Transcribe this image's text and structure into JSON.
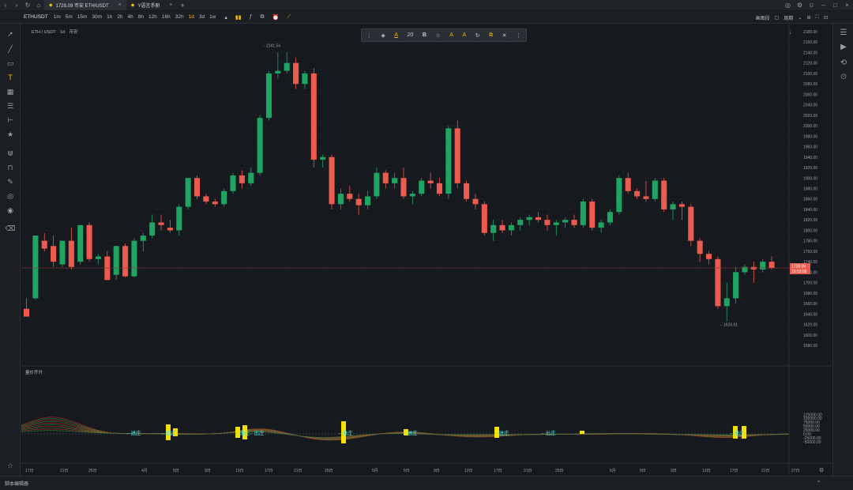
{
  "tabs": [
    {
      "label": "1728.09 币安 ETH/USDT",
      "active": true
    },
    {
      "label": "Y语言手册",
      "active": false
    }
  ],
  "toolbar": {
    "symbol": "ETHUSDT",
    "intervals": [
      "1m",
      "5m",
      "15m",
      "30m",
      "1h",
      "2h",
      "4h",
      "8h",
      "12h",
      "16h",
      "32h",
      "1d",
      "3d",
      "1w"
    ],
    "selected_interval": "1d",
    "right_labels": [
      "画图段",
      "周期"
    ]
  },
  "legend": {
    "pair": "ETH / USDT",
    "interval": "1d",
    "exchange": "币安"
  },
  "drawing_toolbar": {
    "font_size": "20",
    "bold": "B"
  },
  "indicator": {
    "name": "量价齐升"
  },
  "price_axis": {
    "ticks": [
      "2180.00",
      "2160.00",
      "2140.00",
      "2120.00",
      "2100.00",
      "2080.00",
      "2060.00",
      "2040.00",
      "2020.00",
      "2000.00",
      "1980.00",
      "1960.00",
      "1940.00",
      "1920.00",
      "1900.00",
      "1880.00",
      "1860.00",
      "1840.00",
      "1820.00",
      "1800.00",
      "1780.00",
      "1760.00",
      "1740.00",
      "1720.00",
      "1700.00",
      "1680.00",
      "1660.00",
      "1640.00",
      "1620.00",
      "1600.00",
      "1580.00"
    ],
    "last_price": "1728.09",
    "countdown": "15:53:56"
  },
  "ind_axis": {
    "ticks": [
      "125000.00",
      "100000.00",
      "75000.00",
      "50000.00",
      "25000.00",
      "0.00",
      "-25000.00",
      "-50000.00"
    ]
  },
  "high_label": "2141.54",
  "low_label": "1626.01",
  "time_axis": {
    "labels": [
      "17日",
      "21日",
      "25日",
      "4月",
      "5日",
      "9日",
      "13日",
      "17日",
      "21日",
      "25日",
      "5月",
      "5日",
      "9日",
      "13日",
      "17日",
      "21日",
      "25日",
      "6月",
      "5日",
      "9日",
      "13日",
      "17日",
      "21日",
      "27日"
    ]
  },
  "signals": [
    "进庄",
    "出庄",
    "进庄",
    "出庄",
    "进庄",
    "进庄",
    "进庄",
    "出庄",
    "进庄"
  ],
  "bottom": {
    "script_editor": "脚本编辑器"
  },
  "colors": {
    "up": "#1fa463",
    "down": "#ec5b4d",
    "accent": "#f0b90b",
    "signal": "#4fe3e0",
    "volume": "#f5e100",
    "bg": "#161a1e"
  },
  "chart_data": {
    "type": "candlestick",
    "ohlc": [
      [
        1650,
        1670,
        1645,
        1635
      ],
      [
        1670,
        1790,
        1668,
        1790
      ],
      [
        1780,
        1795,
        1760,
        1765
      ],
      [
        1770,
        1790,
        1730,
        1740
      ],
      [
        1735,
        1780,
        1730,
        1780
      ],
      [
        1780,
        1805,
        1725,
        1730
      ],
      [
        1740,
        1810,
        1735,
        1810
      ],
      [
        1810,
        1815,
        1740,
        1745
      ],
      [
        1745,
        1755,
        1735,
        1750
      ],
      [
        1750,
        1760,
        1705,
        1705
      ],
      [
        1715,
        1770,
        1705,
        1770
      ],
      [
        1770,
        1775,
        1710,
        1712
      ],
      [
        1712,
        1785,
        1710,
        1780
      ],
      [
        1780,
        1795,
        1760,
        1790
      ],
      [
        1790,
        1830,
        1785,
        1815
      ],
      [
        1815,
        1830,
        1800,
        1810
      ],
      [
        1805,
        1820,
        1795,
        1800
      ],
      [
        1800,
        1850,
        1790,
        1845
      ],
      [
        1845,
        1900,
        1840,
        1900
      ],
      [
        1900,
        1905,
        1860,
        1865
      ],
      [
        1865,
        1870,
        1850,
        1855
      ],
      [
        1855,
        1860,
        1845,
        1850
      ],
      [
        1850,
        1880,
        1845,
        1875
      ],
      [
        1875,
        1910,
        1870,
        1905
      ],
      [
        1905,
        1915,
        1880,
        1890
      ],
      [
        1890,
        1920,
        1885,
        1910
      ],
      [
        1910,
        2020,
        1905,
        2015
      ],
      [
        2015,
        2105,
        2010,
        2100
      ],
      [
        2100,
        2140,
        2090,
        2105
      ],
      [
        2105,
        2141,
        2100,
        2120
      ],
      [
        2120,
        2130,
        2070,
        2080
      ],
      [
        2080,
        2105,
        2070,
        2100
      ],
      [
        2100,
        2110,
        1920,
        1935
      ],
      [
        1935,
        1945,
        1920,
        1940
      ],
      [
        1940,
        1945,
        1840,
        1850
      ],
      [
        1850,
        1880,
        1840,
        1870
      ],
      [
        1870,
        1885,
        1855,
        1860
      ],
      [
        1860,
        1870,
        1830,
        1848
      ],
      [
        1848,
        1875,
        1840,
        1865
      ],
      [
        1865,
        1920,
        1860,
        1910
      ],
      [
        1910,
        1915,
        1880,
        1890
      ],
      [
        1890,
        1910,
        1880,
        1900
      ],
      [
        1900,
        1920,
        1860,
        1865
      ],
      [
        1865,
        1875,
        1850,
        1870
      ],
      [
        1870,
        1900,
        1865,
        1895
      ],
      [
        1895,
        1910,
        1880,
        1890
      ],
      [
        1890,
        1900,
        1865,
        1870
      ],
      [
        1870,
        2000,
        1860,
        1995
      ],
      [
        1995,
        2010,
        1880,
        1890
      ],
      [
        1890,
        1895,
        1855,
        1860
      ],
      [
        1860,
        1870,
        1840,
        1850
      ],
      [
        1850,
        1855,
        1790,
        1795
      ],
      [
        1795,
        1820,
        1780,
        1810
      ],
      [
        1810,
        1820,
        1795,
        1800
      ],
      [
        1800,
        1815,
        1790,
        1810
      ],
      [
        1810,
        1825,
        1800,
        1820
      ],
      [
        1820,
        1830,
        1810,
        1825
      ],
      [
        1825,
        1835,
        1815,
        1820
      ],
      [
        1820,
        1830,
        1800,
        1810
      ],
      [
        1810,
        1820,
        1790,
        1815
      ],
      [
        1815,
        1825,
        1805,
        1820
      ],
      [
        1820,
        1830,
        1805,
        1810
      ],
      [
        1810,
        1860,
        1805,
        1855
      ],
      [
        1855,
        1860,
        1800,
        1805
      ],
      [
        1805,
        1820,
        1795,
        1815
      ],
      [
        1815,
        1840,
        1810,
        1835
      ],
      [
        1835,
        1905,
        1830,
        1900
      ],
      [
        1900,
        1910,
        1870,
        1875
      ],
      [
        1875,
        1880,
        1860,
        1865
      ],
      [
        1865,
        1895,
        1855,
        1860
      ],
      [
        1860,
        1900,
        1855,
        1895
      ],
      [
        1895,
        1900,
        1835,
        1840
      ],
      [
        1840,
        1855,
        1820,
        1850
      ],
      [
        1850,
        1855,
        1820,
        1845
      ],
      [
        1845,
        1850,
        1770,
        1780
      ],
      [
        1780,
        1785,
        1740,
        1755
      ],
      [
        1755,
        1760,
        1735,
        1745
      ],
      [
        1745,
        1750,
        1650,
        1655
      ],
      [
        1655,
        1700,
        1626,
        1670
      ],
      [
        1670,
        1730,
        1660,
        1720
      ],
      [
        1720,
        1735,
        1715,
        1730
      ],
      [
        1730,
        1740,
        1700,
        1725
      ],
      [
        1725,
        1745,
        1720,
        1740
      ],
      [
        1740,
        1750,
        1725,
        1728
      ]
    ]
  }
}
